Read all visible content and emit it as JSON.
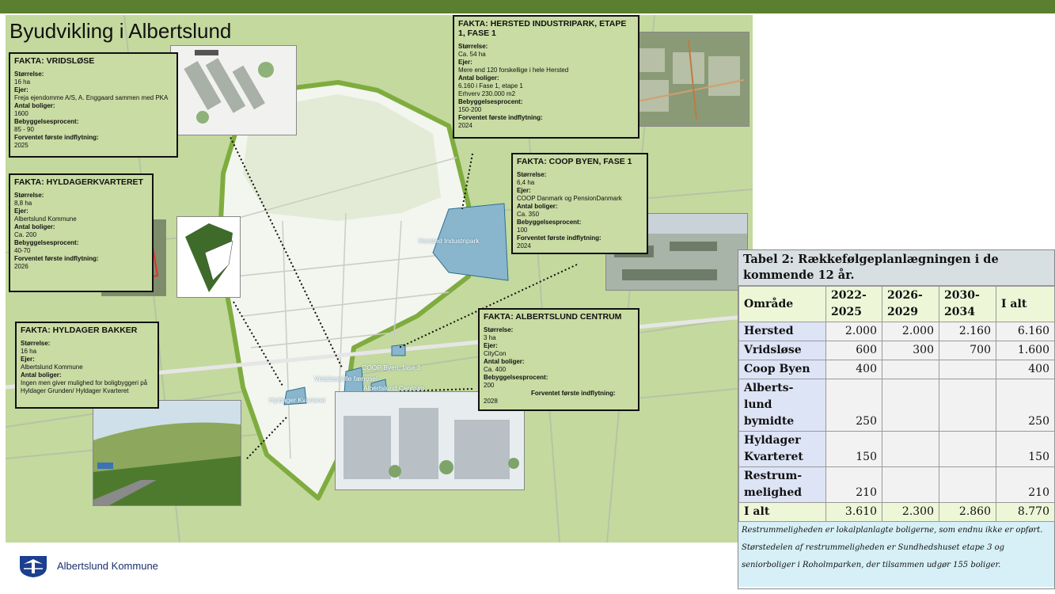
{
  "map_title": "Byudvikling i Albertslund",
  "facts": {
    "vridslose": {
      "title": "FAKTA: VRIDSLØSE",
      "lines": [
        {
          "k": "Størrelse:",
          "v": "16 ha"
        },
        {
          "k": "Ejer:",
          "v": "Freja ejendomme A/S, A. Enggaard sammen med PKA"
        },
        {
          "k": "Antal boliger:",
          "v": "1600"
        },
        {
          "k": "Bebyggelsesprocent:",
          "v": "85 - 90"
        },
        {
          "k": "Forventet første indflytning:",
          "v": "2025"
        }
      ]
    },
    "hyldagerkvarteret": {
      "title": "FAKTA: HYLDAGERKVARTERET",
      "lines": [
        {
          "k": "Størrelse:",
          "v": "8,8 ha"
        },
        {
          "k": "Ejer:",
          "v": "Albertslund Kommune"
        },
        {
          "k": "Antal boliger:",
          "v": "Ca. 200"
        },
        {
          "k": "Bebyggelsesprocent:",
          "v": "40-70"
        },
        {
          "k": "Forventet første indflytning:",
          "v": "2026"
        }
      ]
    },
    "hyldager_bakker": {
      "title": "FAKTA: HYLDAGER BAKKER",
      "lines": [
        {
          "k": "Størrelse:",
          "v": "16 ha"
        },
        {
          "k": "Ejer:",
          "v": "Albertslund Kommune"
        },
        {
          "k": "Antal boliger:",
          "v": "Ingen men giver mulighed for boligbyggeri på Hyldager Grunden/ Hyldager Kvarteret"
        }
      ]
    },
    "hersted": {
      "title": "FAKTA: HERSTED INDUSTRIPARK, ETAPE 1, FASE 1",
      "lines": [
        {
          "k": "Størrelse:",
          "v": "Ca. 54 ha"
        },
        {
          "k": "Ejer:",
          "v": "Mere end 120 forskellige i hele Hersted"
        },
        {
          "k": "Antal boliger:",
          "v": "6.160 i Fase 1, etape 1\nErhverv 230.000 m2"
        },
        {
          "k": "Bebyggelsesprocent:",
          "v": "150-200"
        },
        {
          "k": "Forventet første indflytning:",
          "v": "2024"
        }
      ]
    },
    "coop": {
      "title": "FAKTA: COOP BYEN, FASE 1",
      "lines": [
        {
          "k": "Størrelse:",
          "v": "6,4 ha"
        },
        {
          "k": "Ejer:",
          "v": "COOP Danmark og PensionDanmark"
        },
        {
          "k": "Antal boliger:",
          "v": "Ca. 350"
        },
        {
          "k": "Bebyggelsesprocent:",
          "v": "100"
        },
        {
          "k": "Forventet første indflytning:",
          "v": "2024"
        }
      ]
    },
    "centrum": {
      "title": "FAKTA: ALBERTSLUND CENTRUM",
      "lines": [
        {
          "k": "Størrelse:",
          "v": "3 ha"
        },
        {
          "k": "Ejer:",
          "v": "CityCon"
        },
        {
          "k": "Antal boliger:",
          "v": "Ca. 400"
        },
        {
          "k": "Bebyggelsesprocent:",
          "v": "200"
        },
        {
          "k": "Forventet første indflytning:",
          "v": "2028"
        }
      ]
    }
  },
  "map_labels": {
    "hersted": "Hersted Industripark",
    "coop": "COOP Byen, fase 1",
    "vridslose": "Vridsløselille fængsel",
    "centrum": "Albertslund Centrum",
    "hyldager": "Hyldager Kvarteret"
  },
  "logo_text": "Albertslund Kommune",
  "table": {
    "title": "Tabel 2: Rækkefølgeplanlægningen i de kommende 12 år.",
    "headers": [
      "Område",
      "2022-2025",
      "2026-2029",
      "2030-2034",
      "I alt"
    ],
    "rows": [
      {
        "area": "Hersted",
        "v": [
          "2.000",
          "2.000",
          "2.160",
          "6.160"
        ]
      },
      {
        "area": "Vridsløse",
        "v": [
          "600",
          "300",
          "700",
          "1.600"
        ]
      },
      {
        "area": "Coop Byen",
        "v": [
          "400",
          "",
          "",
          "400"
        ]
      },
      {
        "area": "Alberts-lund bymidte",
        "v": [
          "250",
          "",
          "",
          "250"
        ]
      },
      {
        "area": "Hyldager Kvarteret",
        "v": [
          "150",
          "",
          "",
          "150"
        ]
      },
      {
        "area": "Restrum-melighed",
        "v": [
          "210",
          "",
          "",
          "210"
        ]
      }
    ],
    "total": {
      "area": "I alt",
      "v": [
        "3.610",
        "2.300",
        "2.860",
        "8.770"
      ]
    },
    "note": "Restrummeligheden er lokalplanlagte boligerne, som endnu ikke er opført. Størstedelen af restrummeligheden er Sundhedshuset etape 3 og seniorboliger i Roholmparken, der tilsammen udgør 155 boliger."
  }
}
